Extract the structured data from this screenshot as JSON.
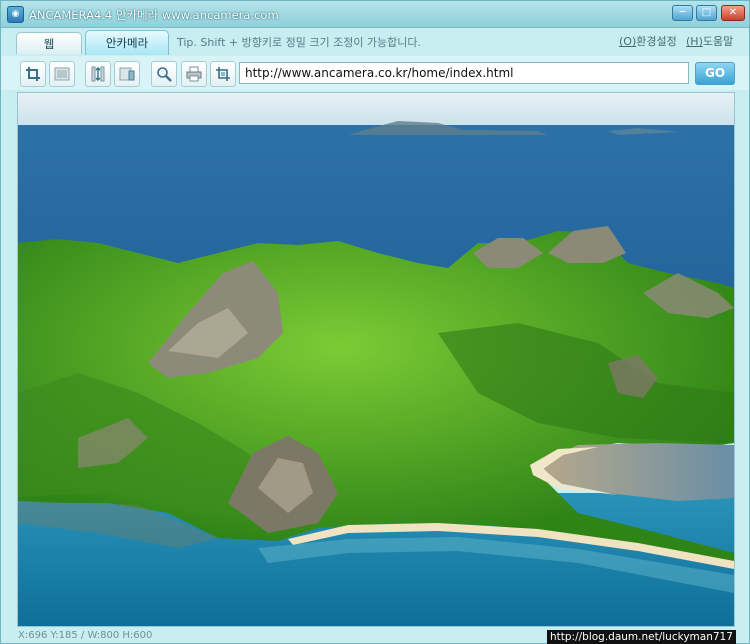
{
  "window": {
    "title": "ANCAMERA4.4 안카메라 www.ancamera.com",
    "icon": "camera-app-icon",
    "minimize": "─",
    "maximize": "□",
    "close": "✕"
  },
  "tabs": [
    {
      "label": "웹",
      "active": false
    },
    {
      "label": "안카메라",
      "active": true
    }
  ],
  "tip": "Tip. Shift + 방향키로 정밀 크기 조정이 가능합니다.",
  "menu": {
    "settings_key": "(O)",
    "settings_label": "환경설정",
    "help_key": "(H)",
    "help_label": "도움말"
  },
  "toolbar": {
    "buttons": [
      "crop-icon",
      "capture-window-icon",
      "resize-vertical-icon",
      "capture-scroll-icon",
      "zoom-icon",
      "print-icon",
      "crop-select-icon"
    ],
    "url": "http://www.ancamera.co.kr/home/index.html",
    "go_label": "GO"
  },
  "status": {
    "coords": "X:696 Y:185 / W:800 H:600"
  },
  "credit": "http://blog.daum.net/luckyman717",
  "colors": {
    "accent": "#3aa2d4",
    "titlebar": "#8fd0db",
    "sea": "#1f6aa0",
    "forest": "#3f9b1c"
  }
}
